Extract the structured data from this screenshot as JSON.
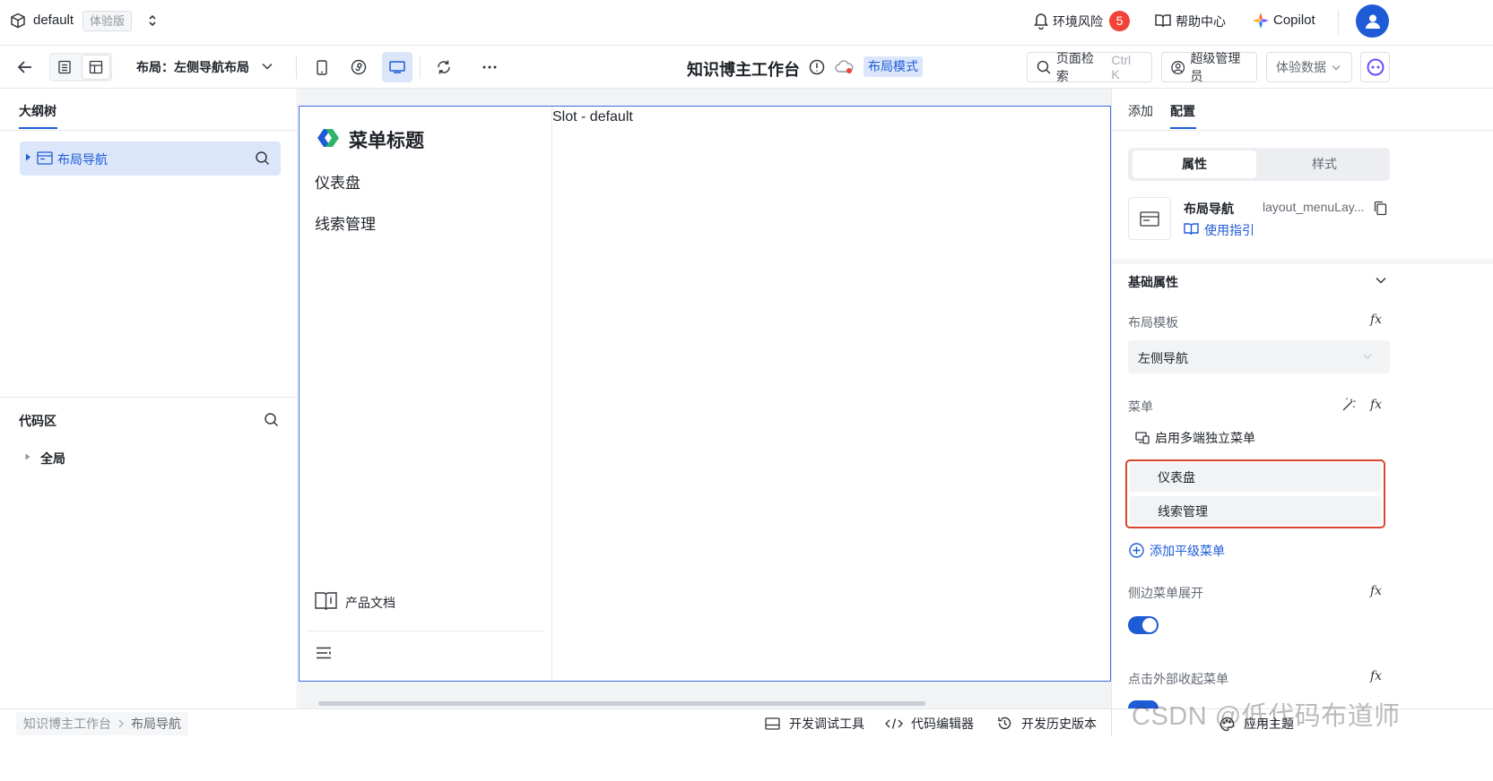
{
  "app": {
    "project_name": "default",
    "edition_badge": "体验版",
    "risk_label": "环境风险",
    "risk_count": "5",
    "help_label": "帮助中心",
    "copilot_label": "Copilot"
  },
  "toolbar": {
    "layout_label": "布局：左侧导航布局",
    "page_title": "知识博主工作台",
    "mode_badge": "布局模式",
    "search_label": "页面检索",
    "search_shortcut": "Ctrl K",
    "admin_label": "超级管理员",
    "data_label": "体验数据"
  },
  "left_panel": {
    "outline_tab": "大纲树",
    "tree_item": "布局导航",
    "code_section_title": "代码区",
    "code_item": "全局"
  },
  "canvas": {
    "menu_title": "菜单标题",
    "menu_items": [
      "仪表盘",
      "线索管理"
    ],
    "footer_doc_label": "产品文档",
    "slot_label": "Slot - default"
  },
  "right_panel": {
    "tabs": [
      "添加",
      "配置"
    ],
    "active_tab": "配置",
    "segments": [
      "属性",
      "样式"
    ],
    "active_segment": "属性",
    "component_name": "布局导航",
    "component_id": "layout_menuLay...",
    "guide_link": "使用指引",
    "section_title": "基础属性",
    "layout_template_label": "布局模板",
    "layout_template_value": "左侧导航",
    "menu_label": "菜单",
    "multi_menu_label": "启用多端独立菜单",
    "menu_list": [
      "仪表盘",
      "线索管理"
    ],
    "add_menu_label": "添加平级菜单",
    "sidebar_expand_label": "侧边菜单展开",
    "sidebar_expand_on": true,
    "click_outside_label": "点击外部收起菜单",
    "fx_label": "fx"
  },
  "bottom_bar": {
    "breadcrumb": [
      "知识博主工作台",
      "布局导航"
    ],
    "debug_tool": "开发调试工具",
    "code_editor": "代码编辑器",
    "history": "开发历史版本",
    "theme": "应用主题",
    "watermark": "CSDN @低代码布道师"
  },
  "colors": {
    "accent": "#1e5bd6",
    "badge_red": "#f04438",
    "highlight_border": "#d9452f",
    "selected_bg": "#dbe6fb"
  }
}
